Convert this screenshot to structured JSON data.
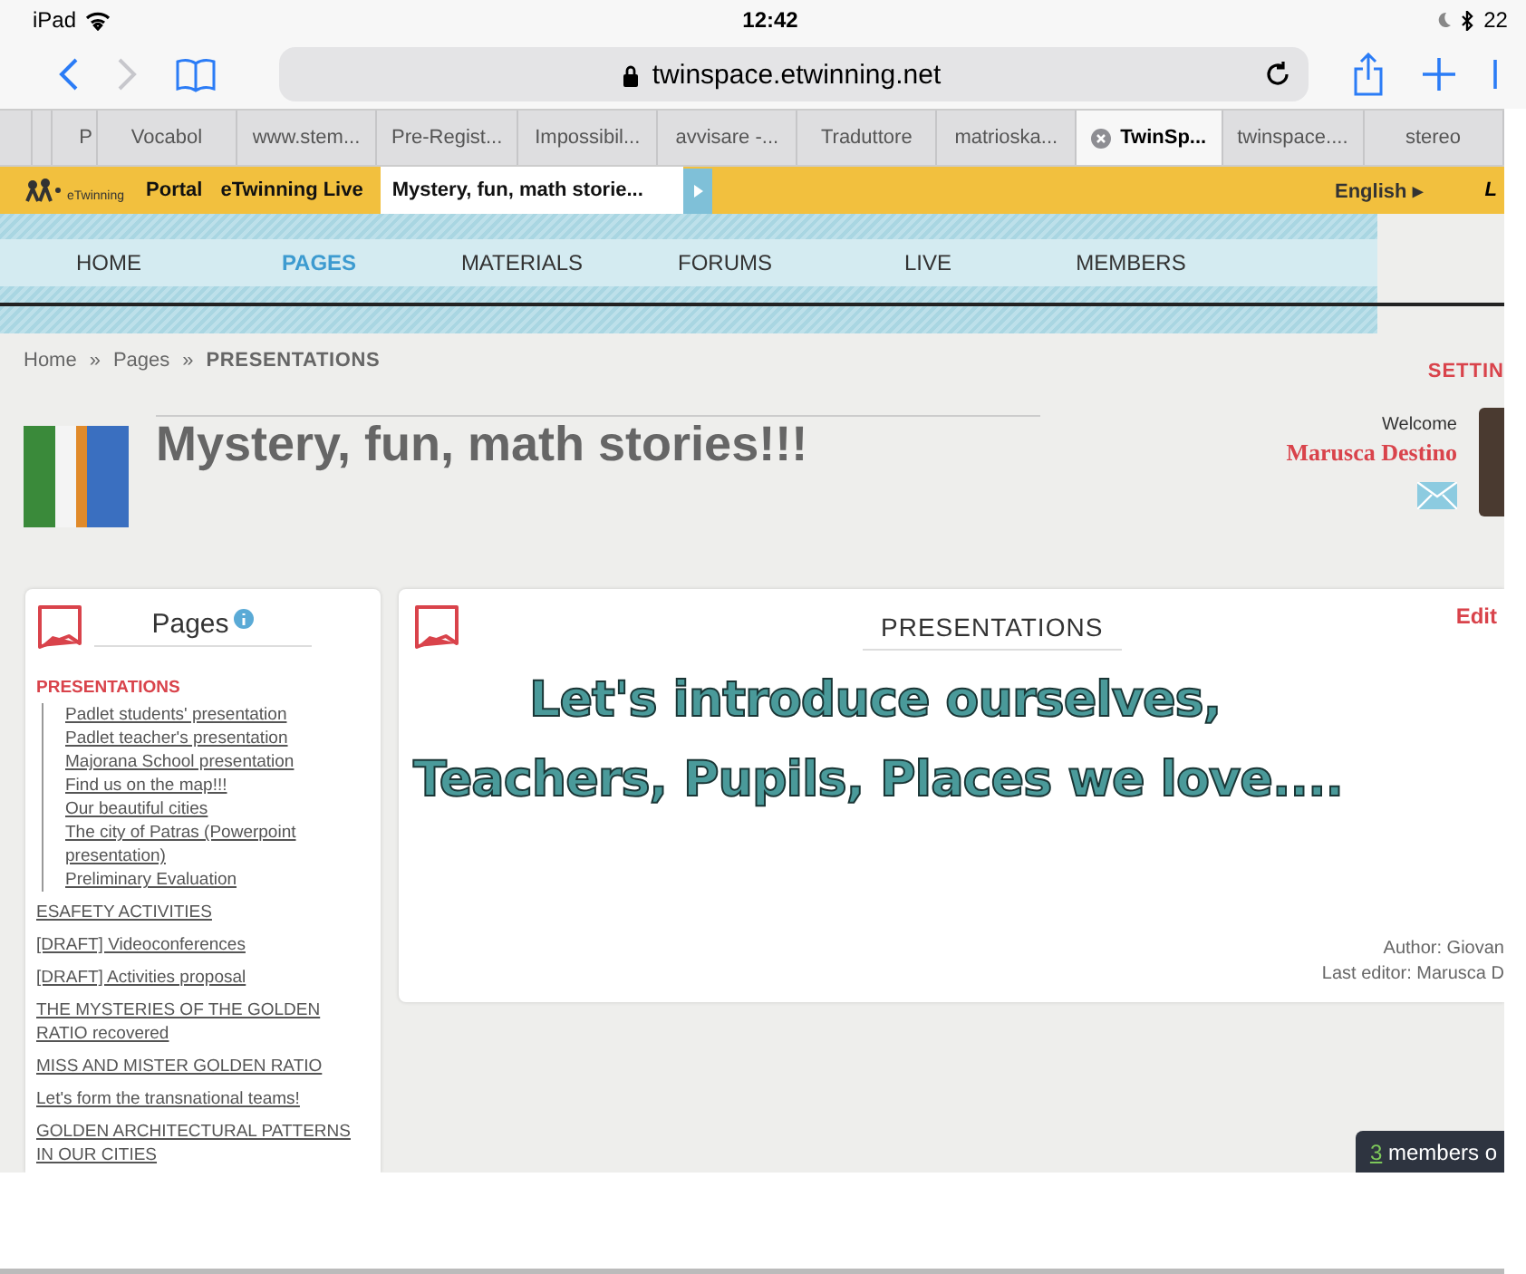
{
  "status_bar": {
    "device": "iPad",
    "time": "12:42",
    "battery": "22"
  },
  "browser": {
    "url": "twinspace.etwinning.net"
  },
  "browser_tabs": [
    {
      "label": "P",
      "selected": false
    },
    {
      "label": "Vocabol",
      "selected": false
    },
    {
      "label": "www.stem...",
      "selected": false
    },
    {
      "label": "Pre-Regist...",
      "selected": false
    },
    {
      "label": "Impossibil...",
      "selected": false
    },
    {
      "label": "avvisare -...",
      "selected": false
    },
    {
      "label": "Traduttore",
      "selected": false
    },
    {
      "label": "matrioska...",
      "selected": false
    },
    {
      "label": "TwinSp...",
      "selected": true
    },
    {
      "label": "twinspace....",
      "selected": false
    },
    {
      "label": "stereo",
      "selected": false
    }
  ],
  "top_bar": {
    "logo": "eTwinning",
    "links": [
      "Portal",
      "eTwinning Live"
    ],
    "project": "Mystery, fun, math storie...",
    "language": "English ▸",
    "login": "L"
  },
  "nav": [
    {
      "label": "HOME",
      "selected": false
    },
    {
      "label": "PAGES",
      "selected": true
    },
    {
      "label": "MATERIALS",
      "selected": false
    },
    {
      "label": "FORUMS",
      "selected": false
    },
    {
      "label": "LIVE",
      "selected": false
    },
    {
      "label": "MEMBERS",
      "selected": false
    }
  ],
  "breadcrumb": [
    "Home",
    "»",
    "Pages",
    "»",
    "PRESENTATIONS"
  ],
  "settings": "SETTIN",
  "project_title": "Mystery, fun, math stories!!!",
  "welcome": {
    "label": "Welcome",
    "user": "Marusca Destino"
  },
  "sidebar": {
    "title": "Pages",
    "items": [
      {
        "label": "PRESENTATIONS",
        "selected": true,
        "children": [
          {
            "label": "Padlet students' presentation",
            "selected": false
          },
          {
            "label": "Padlet teacher's presentation",
            "selected": false
          },
          {
            "label": "Majorana School presentation",
            "selected": false
          },
          {
            "label": "Find us on the map!!!",
            "selected": false
          },
          {
            "label": "Our beautiful cities",
            "selected": false
          },
          {
            "label": "The city of Patras (Powerpoint presentation)",
            "selected": false
          },
          {
            "label": "Preliminary Evaluation",
            "selected": false
          }
        ]
      },
      {
        "label": "ESAFETY ACTIVITIES",
        "selected": false
      },
      {
        "label": "[DRAFT] Videoconferences",
        "selected": false
      },
      {
        "label": "[DRAFT] Activities proposal",
        "selected": false
      },
      {
        "label": "THE MYSTERIES OF THE GOLDEN RATIO recovered",
        "selected": false
      },
      {
        "label": "MISS AND MISTER GOLDEN RATIO",
        "selected": false
      },
      {
        "label": "Let's form the transnational teams!",
        "selected": false
      },
      {
        "label": "GOLDEN ARCHITECTURAL PATTERNS IN OUR CITIES",
        "selected": false
      }
    ]
  },
  "content": {
    "title": "PRESENTATIONS",
    "edit": "Edit",
    "banner": [
      "Let's introduce ourselves,",
      "Teachers, Pupils, Places we love...."
    ],
    "author": "Author: Giovan",
    "last_editor": "Last editor: Marusca D"
  },
  "members_online": {
    "count": "3",
    "label": "members o"
  }
}
